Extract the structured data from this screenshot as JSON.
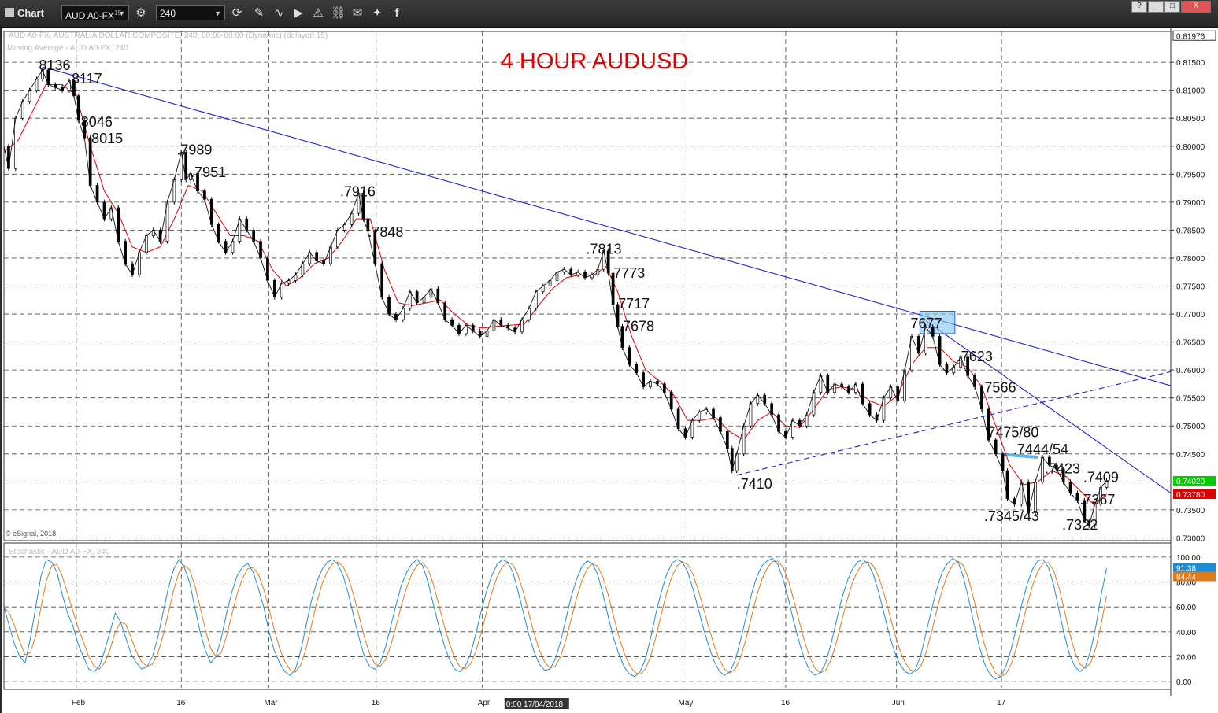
{
  "window": {
    "title": "Chart",
    "symbol": "AUD A0-FX",
    "symbol_superscript": "15",
    "interval": "240",
    "icons": [
      "gear-icon",
      "refresh-icon",
      "pencil-icon",
      "curve-icon",
      "play-icon",
      "alert-icon",
      "link-icon",
      "comment-icon",
      "twitter-icon",
      "facebook-icon"
    ],
    "window_buttons": [
      "?",
      "_",
      "□",
      "X"
    ]
  },
  "chart_data": {
    "type": "line",
    "title": "4 HOUR AUDUSD",
    "title_color": "#e00000",
    "header_line1": "AUD A0-FX, AUSTRALIA DOLLAR COMPOSITE, 240, 00:00-00:00 (Dynamic) (delayed 15)",
    "header_line2": "Moving Average - AUD A0-FX, 240",
    "copyright": "© eSignal, 2018",
    "ylim": [
      0.7295,
      0.8205
    ],
    "y_ticks": [
      "0.81500",
      "0.81000",
      "0.80500",
      "0.80000",
      "0.79500",
      "0.79000",
      "0.78500",
      "0.78000",
      "0.77500",
      "0.77000",
      "0.76500",
      "0.76000",
      "0.75500",
      "0.75000",
      "0.74500",
      "0.74000",
      "0.73500",
      "0.73000"
    ],
    "y_top_label": "0.81976",
    "x_labels": [
      {
        "t": 0.062,
        "label": "Feb"
      },
      {
        "t": 0.152,
        "label": "16"
      },
      {
        "t": 0.227,
        "label": "Mar"
      },
      {
        "t": 0.319,
        "label": "16"
      },
      {
        "t": 0.41,
        "label": "Apr"
      },
      {
        "t": 0.582,
        "label": "May"
      },
      {
        "t": 0.67,
        "label": "16"
      },
      {
        "t": 0.765,
        "label": "Jun"
      },
      {
        "t": 0.855,
        "label": "17"
      }
    ],
    "cursor_time_label": "0:00 17/04/2018",
    "price_line_color": "#000000",
    "ma_color": "#e00000",
    "trendline_color": "#2222cc",
    "price_path": [
      [
        0.0,
        0.8
      ],
      [
        0.004,
        0.796
      ],
      [
        0.01,
        0.805
      ],
      [
        0.016,
        0.808
      ],
      [
        0.022,
        0.81
      ],
      [
        0.028,
        0.812
      ],
      [
        0.033,
        0.8136
      ],
      [
        0.038,
        0.811
      ],
      [
        0.044,
        0.8105
      ],
      [
        0.05,
        0.81
      ],
      [
        0.056,
        0.8117
      ],
      [
        0.06,
        0.809
      ],
      [
        0.064,
        0.8046
      ],
      [
        0.069,
        0.8015
      ],
      [
        0.074,
        0.793
      ],
      [
        0.08,
        0.79
      ],
      [
        0.086,
        0.787
      ],
      [
        0.092,
        0.789
      ],
      [
        0.098,
        0.783
      ],
      [
        0.104,
        0.779
      ],
      [
        0.11,
        0.777
      ],
      [
        0.116,
        0.781
      ],
      [
        0.122,
        0.784
      ],
      [
        0.128,
        0.785
      ],
      [
        0.134,
        0.783
      ],
      [
        0.14,
        0.79
      ],
      [
        0.146,
        0.794
      ],
      [
        0.152,
        0.7989
      ],
      [
        0.156,
        0.794
      ],
      [
        0.16,
        0.7951
      ],
      [
        0.166,
        0.792
      ],
      [
        0.172,
        0.7905
      ],
      [
        0.178,
        0.786
      ],
      [
        0.184,
        0.783
      ],
      [
        0.19,
        0.781
      ],
      [
        0.196,
        0.783
      ],
      [
        0.202,
        0.787
      ],
      [
        0.208,
        0.785
      ],
      [
        0.214,
        0.783
      ],
      [
        0.22,
        0.78
      ],
      [
        0.226,
        0.776
      ],
      [
        0.232,
        0.773
      ],
      [
        0.238,
        0.7755
      ],
      [
        0.244,
        0.776
      ],
      [
        0.25,
        0.777
      ],
      [
        0.256,
        0.779
      ],
      [
        0.262,
        0.781
      ],
      [
        0.268,
        0.7795
      ],
      [
        0.274,
        0.779
      ],
      [
        0.28,
        0.782
      ],
      [
        0.286,
        0.785
      ],
      [
        0.292,
        0.786
      ],
      [
        0.298,
        0.788
      ],
      [
        0.304,
        0.7916
      ],
      [
        0.308,
        0.787
      ],
      [
        0.312,
        0.7848
      ],
      [
        0.318,
        0.779
      ],
      [
        0.324,
        0.773
      ],
      [
        0.33,
        0.77
      ],
      [
        0.336,
        0.769
      ],
      [
        0.342,
        0.771
      ],
      [
        0.348,
        0.774
      ],
      [
        0.354,
        0.772
      ],
      [
        0.36,
        0.773
      ],
      [
        0.366,
        0.7745
      ],
      [
        0.372,
        0.772
      ],
      [
        0.378,
        0.769
      ],
      [
        0.384,
        0.768
      ],
      [
        0.39,
        0.7665
      ],
      [
        0.396,
        0.768
      ],
      [
        0.402,
        0.767
      ],
      [
        0.408,
        0.766
      ],
      [
        0.414,
        0.767
      ],
      [
        0.42,
        0.769
      ],
      [
        0.426,
        0.768
      ],
      [
        0.432,
        0.7675
      ],
      [
        0.438,
        0.7668
      ],
      [
        0.444,
        0.769
      ],
      [
        0.45,
        0.771
      ],
      [
        0.456,
        0.774
      ],
      [
        0.462,
        0.775
      ],
      [
        0.468,
        0.776
      ],
      [
        0.474,
        0.7775
      ],
      [
        0.48,
        0.778
      ],
      [
        0.486,
        0.777
      ],
      [
        0.492,
        0.7775
      ],
      [
        0.498,
        0.7765
      ],
      [
        0.504,
        0.777
      ],
      [
        0.509,
        0.778
      ],
      [
        0.514,
        0.7813
      ],
      [
        0.518,
        0.7773
      ],
      [
        0.522,
        0.7717
      ],
      [
        0.526,
        0.7678
      ],
      [
        0.53,
        0.764
      ],
      [
        0.536,
        0.761
      ],
      [
        0.542,
        0.7595
      ],
      [
        0.548,
        0.757
      ],
      [
        0.554,
        0.758
      ],
      [
        0.56,
        0.7575
      ],
      [
        0.566,
        0.756
      ],
      [
        0.572,
        0.753
      ],
      [
        0.578,
        0.7495
      ],
      [
        0.584,
        0.748
      ],
      [
        0.59,
        0.751
      ],
      [
        0.596,
        0.7525
      ],
      [
        0.602,
        0.753
      ],
      [
        0.608,
        0.7515
      ],
      [
        0.614,
        0.749
      ],
      [
        0.62,
        0.746
      ],
      [
        0.624,
        0.742
      ],
      [
        0.628,
        0.745
      ],
      [
        0.634,
        0.75
      ],
      [
        0.64,
        0.754
      ],
      [
        0.646,
        0.7555
      ],
      [
        0.652,
        0.754
      ],
      [
        0.658,
        0.752
      ],
      [
        0.664,
        0.749
      ],
      [
        0.67,
        0.748
      ],
      [
        0.676,
        0.751
      ],
      [
        0.682,
        0.75
      ],
      [
        0.688,
        0.752
      ],
      [
        0.694,
        0.756
      ],
      [
        0.7,
        0.759
      ],
      [
        0.706,
        0.756
      ],
      [
        0.712,
        0.7575
      ],
      [
        0.718,
        0.757
      ],
      [
        0.724,
        0.756
      ],
      [
        0.73,
        0.7575
      ],
      [
        0.736,
        0.754
      ],
      [
        0.742,
        0.752
      ],
      [
        0.748,
        0.751
      ],
      [
        0.754,
        0.755
      ],
      [
        0.76,
        0.757
      ],
      [
        0.766,
        0.7545
      ],
      [
        0.772,
        0.76
      ],
      [
        0.778,
        0.766
      ],
      [
        0.784,
        0.763
      ],
      [
        0.79,
        0.7677
      ],
      [
        0.796,
        0.766
      ],
      [
        0.802,
        0.761
      ],
      [
        0.808,
        0.7595
      ],
      [
        0.814,
        0.7605
      ],
      [
        0.82,
        0.7623
      ],
      [
        0.826,
        0.759
      ],
      [
        0.832,
        0.757
      ],
      [
        0.838,
        0.753
      ],
      [
        0.844,
        0.7475
      ],
      [
        0.85,
        0.745
      ],
      [
        0.856,
        0.742
      ],
      [
        0.86,
        0.737
      ],
      [
        0.866,
        0.736
      ],
      [
        0.872,
        0.74
      ],
      [
        0.878,
        0.7345
      ],
      [
        0.884,
        0.74
      ],
      [
        0.89,
        0.7444
      ],
      [
        0.896,
        0.743
      ],
      [
        0.902,
        0.7423
      ],
      [
        0.908,
        0.74
      ],
      [
        0.914,
        0.738
      ],
      [
        0.92,
        0.7367
      ],
      [
        0.926,
        0.733
      ],
      [
        0.93,
        0.7322
      ],
      [
        0.935,
        0.736
      ],
      [
        0.94,
        0.739
      ],
      [
        0.945,
        0.7402
      ]
    ],
    "ma_path": [
      [
        0.0,
        0.799
      ],
      [
        0.012,
        0.801
      ],
      [
        0.024,
        0.806
      ],
      [
        0.036,
        0.811
      ],
      [
        0.05,
        0.811
      ],
      [
        0.062,
        0.809
      ],
      [
        0.074,
        0.8
      ],
      [
        0.086,
        0.792
      ],
      [
        0.098,
        0.788
      ],
      [
        0.11,
        0.782
      ],
      [
        0.122,
        0.781
      ],
      [
        0.134,
        0.782
      ],
      [
        0.146,
        0.787
      ],
      [
        0.158,
        0.793
      ],
      [
        0.17,
        0.792
      ],
      [
        0.182,
        0.788
      ],
      [
        0.194,
        0.784
      ],
      [
        0.206,
        0.784
      ],
      [
        0.218,
        0.783
      ],
      [
        0.23,
        0.778
      ],
      [
        0.242,
        0.775
      ],
      [
        0.254,
        0.7765
      ],
      [
        0.266,
        0.779
      ],
      [
        0.278,
        0.78
      ],
      [
        0.29,
        0.783
      ],
      [
        0.302,
        0.787
      ],
      [
        0.314,
        0.787
      ],
      [
        0.326,
        0.778
      ],
      [
        0.338,
        0.772
      ],
      [
        0.35,
        0.7715
      ],
      [
        0.362,
        0.772
      ],
      [
        0.374,
        0.7725
      ],
      [
        0.386,
        0.77
      ],
      [
        0.398,
        0.768
      ],
      [
        0.41,
        0.7675
      ],
      [
        0.422,
        0.7678
      ],
      [
        0.434,
        0.768
      ],
      [
        0.446,
        0.7682
      ],
      [
        0.458,
        0.7715
      ],
      [
        0.47,
        0.7745
      ],
      [
        0.482,
        0.7765
      ],
      [
        0.494,
        0.777
      ],
      [
        0.506,
        0.777
      ],
      [
        0.516,
        0.7785
      ],
      [
        0.526,
        0.774
      ],
      [
        0.538,
        0.766
      ],
      [
        0.55,
        0.76
      ],
      [
        0.562,
        0.758
      ],
      [
        0.574,
        0.7555
      ],
      [
        0.586,
        0.751
      ],
      [
        0.598,
        0.751
      ],
      [
        0.61,
        0.7515
      ],
      [
        0.622,
        0.749
      ],
      [
        0.634,
        0.7475
      ],
      [
        0.646,
        0.751
      ],
      [
        0.658,
        0.7525
      ],
      [
        0.67,
        0.75
      ],
      [
        0.682,
        0.7498
      ],
      [
        0.694,
        0.753
      ],
      [
        0.706,
        0.7565
      ],
      [
        0.718,
        0.757
      ],
      [
        0.73,
        0.7565
      ],
      [
        0.742,
        0.7545
      ],
      [
        0.754,
        0.7535
      ],
      [
        0.766,
        0.7555
      ],
      [
        0.778,
        0.761
      ],
      [
        0.79,
        0.764
      ],
      [
        0.802,
        0.764
      ],
      [
        0.814,
        0.7615
      ],
      [
        0.826,
        0.7605
      ],
      [
        0.838,
        0.757
      ],
      [
        0.85,
        0.75
      ],
      [
        0.862,
        0.743
      ],
      [
        0.874,
        0.7395
      ],
      [
        0.886,
        0.74
      ],
      [
        0.898,
        0.742
      ],
      [
        0.91,
        0.741
      ],
      [
        0.922,
        0.7385
      ],
      [
        0.934,
        0.736
      ],
      [
        0.945,
        0.7378
      ]
    ],
    "trendlines": [
      {
        "name": "long-resistance",
        "from": [
          0.033,
          0.8142
        ],
        "to": [
          1.0,
          0.7572
        ],
        "dashed": false
      },
      {
        "name": "short-resistance",
        "from": [
          0.79,
          0.7688
        ],
        "to": [
          1.0,
          0.738
        ],
        "dashed": false
      },
      {
        "name": "rising-support",
        "from": [
          0.628,
          0.7412
        ],
        "to": [
          1.0,
          0.7597
        ],
        "dashed": true
      }
    ],
    "highlight_box": {
      "from": [
        0.785,
        0.7705
      ],
      "to": [
        0.815,
        0.7665
      ]
    },
    "highlight_line": {
      "from": [
        0.856,
        0.7449
      ],
      "to": [
        0.886,
        0.7444
      ]
    },
    "annotations": [
      {
        "text": "8136",
        "x": 0.03,
        "y": 0.8136
      },
      {
        "text": "8117",
        "x": 0.058,
        "y": 0.8112
      },
      {
        "text": "8046",
        "x": 0.066,
        "y": 0.8035
      },
      {
        "text": "8015",
        "x": 0.075,
        "y": 0.8005
      },
      {
        "text": ".7989",
        "x": 0.148,
        "y": 0.7985
      },
      {
        "text": ".7951",
        "x": 0.16,
        "y": 0.7945
      },
      {
        "text": ".7916",
        "x": 0.288,
        "y": 0.791
      },
      {
        "text": ".7848",
        "x": 0.312,
        "y": 0.7838
      },
      {
        "text": ".7813",
        "x": 0.499,
        "y": 0.7808
      },
      {
        "text": ".7773",
        "x": 0.519,
        "y": 0.7765
      },
      {
        "text": ".7717",
        "x": 0.523,
        "y": 0.771
      },
      {
        "text": ".7678",
        "x": 0.527,
        "y": 0.767
      },
      {
        "text": ".7410",
        "x": 0.628,
        "y": 0.7388
      },
      {
        "text": "7677",
        "x": 0.777,
        "y": 0.7675
      },
      {
        "text": ".7623",
        "x": 0.817,
        "y": 0.7616
      },
      {
        "text": ".7566",
        "x": 0.837,
        "y": 0.756
      },
      {
        "text": "7475/80",
        "x": 0.843,
        "y": 0.748
      },
      {
        "text": ".7444/54",
        "x": 0.865,
        "y": 0.745
      },
      {
        "text": ".7423",
        "x": 0.892,
        "y": 0.7415
      },
      {
        "text": ".7409",
        "x": 0.925,
        "y": 0.74
      },
      {
        "text": ".7367",
        "x": 0.922,
        "y": 0.736
      },
      {
        "text": ".7345/43",
        "x": 0.84,
        "y": 0.733
      },
      {
        "text": ".7322",
        "x": 0.907,
        "y": 0.7315
      }
    ],
    "price_tags": [
      {
        "value": "0.74020",
        "price": 0.7402,
        "color": "#00cc00"
      },
      {
        "value": "0.73780",
        "price": 0.7378,
        "color": "#dd0000"
      }
    ],
    "stochastic": {
      "header": "Stochastic - AUD A0-FX, 240",
      "ylim": [
        -5,
        105
      ],
      "y_ticks": [
        "100.00",
        "80.00",
        "60.00",
        "40.00",
        "20.00",
        "0.00"
      ],
      "k_color": "#1f8dd6",
      "d_color": "#e07b1a",
      "tags": [
        {
          "value": "91.38",
          "color": "#1f8dd6",
          "level": 91.38
        },
        {
          "value": "84.44",
          "color": "#e07b1a",
          "level": 84.44
        }
      ],
      "k_values": [
        60,
        45,
        30,
        20,
        15,
        35,
        60,
        85,
        98,
        96,
        88,
        70,
        55,
        45,
        30,
        20,
        10,
        8,
        12,
        25,
        40,
        55,
        48,
        35,
        22,
        15,
        10,
        12,
        20,
        35,
        55,
        75,
        90,
        98,
        92,
        80,
        60,
        40,
        25,
        15,
        20,
        35,
        55,
        72,
        85,
        92,
        95,
        88,
        75,
        60,
        40,
        25,
        15,
        8,
        5,
        10,
        25,
        45,
        65,
        80,
        90,
        96,
        98,
        94,
        85,
        70,
        52,
        35,
        20,
        12,
        10,
        15,
        28,
        45,
        62,
        78,
        88,
        95,
        98,
        93,
        80,
        62,
        45,
        30,
        18,
        10,
        8,
        12,
        22,
        38,
        56,
        72,
        85,
        94,
        98,
        96,
        88,
        72,
        55,
        38,
        24,
        14,
        9,
        10,
        18,
        32,
        50,
        68,
        82,
        92,
        97,
        95,
        86,
        70,
        52,
        35,
        22,
        12,
        6,
        4,
        8,
        18,
        35,
        55,
        72,
        86,
        95,
        98,
        96,
        88,
        74,
        58,
        42,
        28,
        16,
        8,
        5,
        8,
        18,
        34,
        52,
        70,
        84,
        93,
        97,
        99,
        94,
        82,
        66,
        48,
        32,
        18,
        9,
        5,
        7,
        15,
        30,
        48,
        66,
        80,
        90,
        96,
        98,
        95,
        86,
        72,
        55,
        38,
        24,
        14,
        8,
        6,
        10,
        22,
        40,
        58,
        75,
        88,
        95,
        99,
        96,
        84,
        66,
        46,
        28,
        14,
        6,
        2,
        4,
        12,
        26,
        44,
        62,
        78,
        90,
        97,
        98,
        92,
        78,
        58,
        38,
        22,
        12,
        8,
        12,
        25,
        45,
        70,
        91
      ]
    }
  }
}
